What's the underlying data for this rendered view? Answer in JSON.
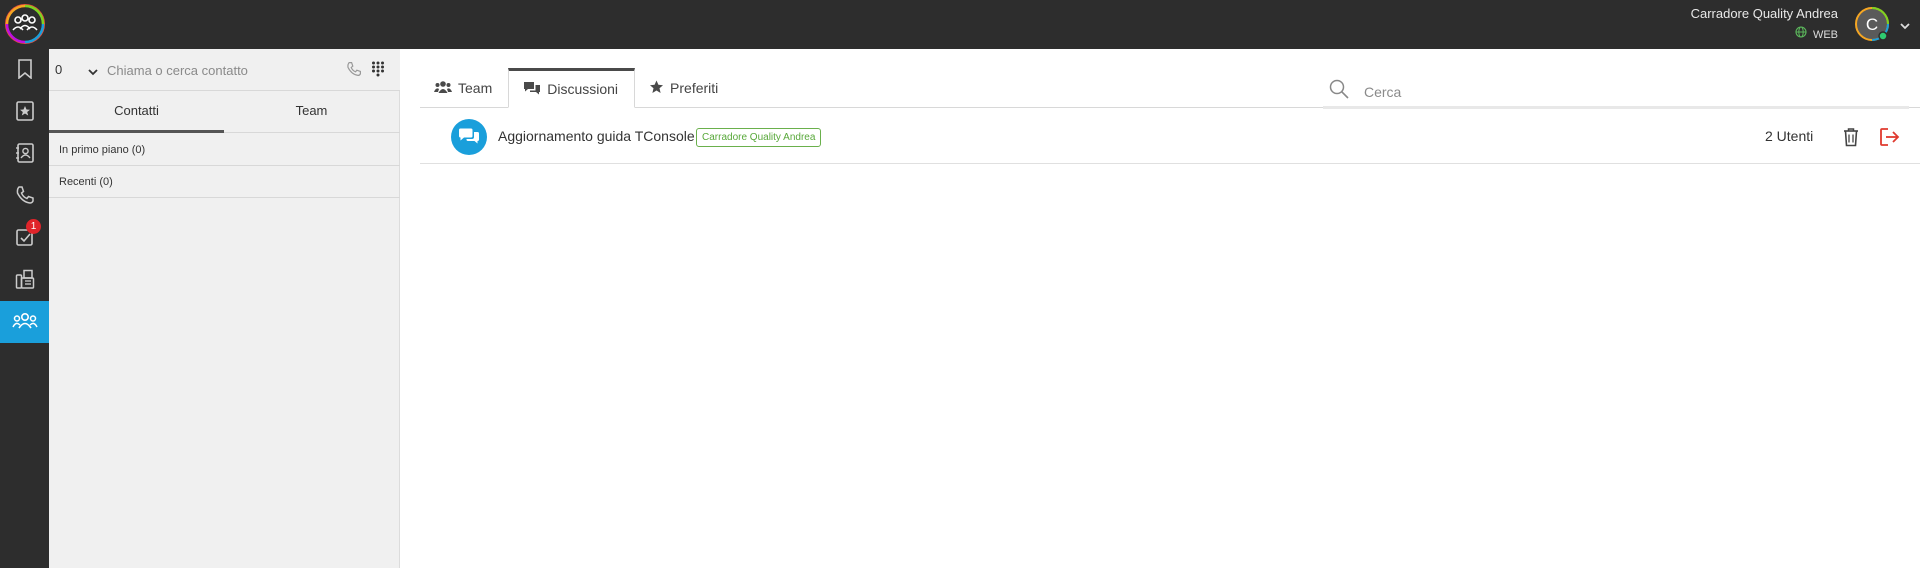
{
  "colors": {
    "accent": "#1a9fdb",
    "topbar": "#2d2d2d",
    "badge": "#e0242a",
    "tag_green": "#58a83a",
    "leave_red": "#e03a2f"
  },
  "header": {
    "user_name": "Carradore Quality Andrea",
    "mode_label": "WEB",
    "avatar_initial": "C",
    "icons": [
      "app-logo-icon",
      "globe-icon",
      "chevron-down-icon"
    ]
  },
  "rail": {
    "items": [
      {
        "name": "bookmark",
        "icon": "bookmark-icon"
      },
      {
        "name": "favorites",
        "icon": "star-book-icon"
      },
      {
        "name": "contacts",
        "icon": "contact-book-icon"
      },
      {
        "name": "calls",
        "icon": "phone-icon"
      },
      {
        "name": "tasks",
        "icon": "checklist-icon",
        "badge": "1"
      },
      {
        "name": "fax",
        "icon": "fax-icon"
      },
      {
        "name": "team",
        "icon": "group-icon",
        "active": true
      }
    ]
  },
  "contacts_panel": {
    "count": "0",
    "search_placeholder": "Chiama o cerca contatto",
    "tabs": [
      {
        "label": "Contatti",
        "active": true
      },
      {
        "label": "Team",
        "active": false
      }
    ],
    "sections": [
      {
        "label": "In primo piano (0)"
      },
      {
        "label": "Recenti (0)"
      }
    ]
  },
  "main": {
    "tabs": [
      {
        "label": "Team",
        "icon": "users-icon",
        "active": false
      },
      {
        "label": "Discussioni",
        "icon": "comments-icon",
        "active": true
      },
      {
        "label": "Preferiti",
        "icon": "star-icon",
        "active": false
      }
    ],
    "search_placeholder": "Cerca",
    "discussions": [
      {
        "title": "Aggiornamento guida TConsole",
        "owner": "Carradore Quality Andrea",
        "users": "2 Utenti"
      }
    ]
  }
}
